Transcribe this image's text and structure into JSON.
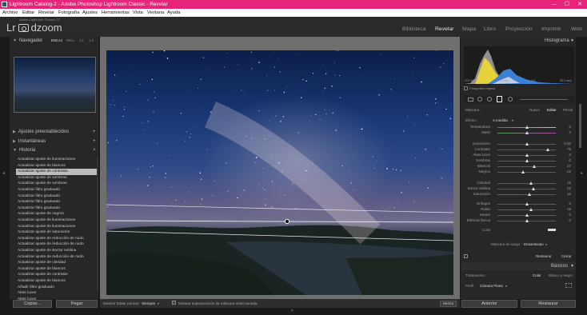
{
  "window": {
    "title": "Lightroom Catalog-2 - Adobe Photoshop Lightroom Classic - Revelar",
    "controls": [
      "—",
      "☐",
      "✕"
    ]
  },
  "menu": [
    "Archivo",
    "Editar",
    "Revelar",
    "Fotografía",
    "Ajustes",
    "Herramientas",
    "Vista",
    "Ventana",
    "Ayuda"
  ],
  "identity": {
    "catalog": "Adobe Lightroom Classic CC",
    "logo_text": "Lr",
    "brand": "dzoom"
  },
  "modules": [
    "Biblioteca",
    "Revelar",
    "Mapa",
    "Libro",
    "Proyección",
    "Imprimir",
    "Web"
  ],
  "left": {
    "navigator": "Navegador",
    "nav_zoom": [
      "ENCAJ",
      "RELL",
      "1:1",
      "1:3"
    ],
    "presets": "Ajustes preestablecidos",
    "snapshots": "Instantáneas",
    "history": "Historia",
    "history_items": [
      "Actualizar ajuste de iluminaciones",
      "Actualizar ajuste de blancos",
      "Actualizar ajuste de contraste",
      "Actualizar ajuste de sombras",
      "Actualizar ajuste de sombras",
      "Actualizar filtro graduado",
      "Actualizar filtro graduado",
      "Actualizar filtro graduado",
      "Actualizar filtro graduado",
      "Actualizar ajuste de negros",
      "Actualizar ajuste de iluminaciones",
      "Actualizar ajuste de iluminaciones",
      "Actualizar ajuste de saturación",
      "Actualizar ajuste de reducción de ruido",
      "Actualizar ajuste de reducción de ruido",
      "Actualizar ajuste de Borrar neblina",
      "Actualizar ajuste de reducción de ruido",
      "Actualizar ajuste de claridad",
      "Actualizar ajuste de blancos",
      "Actualizar ajuste de contraste",
      "Actualizar ajuste de blancos",
      "Añadir filtro graduado",
      "Altas luces",
      "Altas luces"
    ],
    "copy_btn": "Copiar...",
    "paste_btn": "Pegar"
  },
  "toolbar": {
    "edit_pins_label": "Mostrar Editar puntos:",
    "edit_pins_value": "Siempre",
    "mask_overlay": "Mostrar superposición de máscara seleccionada",
    "done": "Hecho"
  },
  "right": {
    "histogram": "Histograma",
    "exif": [
      "ISO 6400",
      "11 mm",
      "f / 2.8",
      "30.0 seg"
    ],
    "original": "Fotografía original",
    "mask_label": "Máscara :",
    "mask_tabs": [
      "Nuevo",
      "Editar",
      "Pincel"
    ],
    "effect_label": "Efecto :",
    "effect_value": "A medida",
    "sliders": [
      {
        "name": "Temperatura",
        "value": "0",
        "pos": 0.5
      },
      {
        "name": "Matiz",
        "value": "0",
        "pos": 0.5
      },
      {
        "name": "Exposición",
        "value": "0,00",
        "pos": 0.5
      },
      {
        "name": "Contraste",
        "value": "75",
        "pos": 0.86
      },
      {
        "name": "Altas luces",
        "value": "0",
        "pos": 0.5
      },
      {
        "name": "Sombras",
        "value": "0",
        "pos": 0.5
      },
      {
        "name": "Blancos",
        "value": "27",
        "pos": 0.63
      },
      {
        "name": "Negros",
        "value": "-12",
        "pos": 0.44
      },
      {
        "name": "Claridad",
        "value": "15",
        "pos": 0.57
      },
      {
        "name": "Borrar neblina",
        "value": "22",
        "pos": 0.61
      },
      {
        "name": "Saturación",
        "value": "10",
        "pos": 0.55
      },
      {
        "name": "Enfoque",
        "value": "0",
        "pos": 0.5
      },
      {
        "name": "Ruido",
        "value": "15",
        "pos": 0.57
      },
      {
        "name": "Muaré",
        "value": "0",
        "pos": 0.5
      },
      {
        "name": "Eliminar flecos",
        "value": "0",
        "pos": 0.5
      }
    ],
    "color_label": "Color",
    "range_mask_label": "Máscara de rango :",
    "range_mask_value": "Desactivado",
    "reset": "Restaurar",
    "close": "Cerrar",
    "basic": "Básicos",
    "treatment_label": "Tratamiento :",
    "treatment_opts": [
      "Color",
      "Blanco y negro"
    ],
    "profile_label": "Perfil :",
    "profile_value": "Cámara Plana",
    "prev_btn": "Anterior",
    "reset_btn": "Restaurar"
  },
  "colors": {
    "accent": "#e8247a"
  }
}
